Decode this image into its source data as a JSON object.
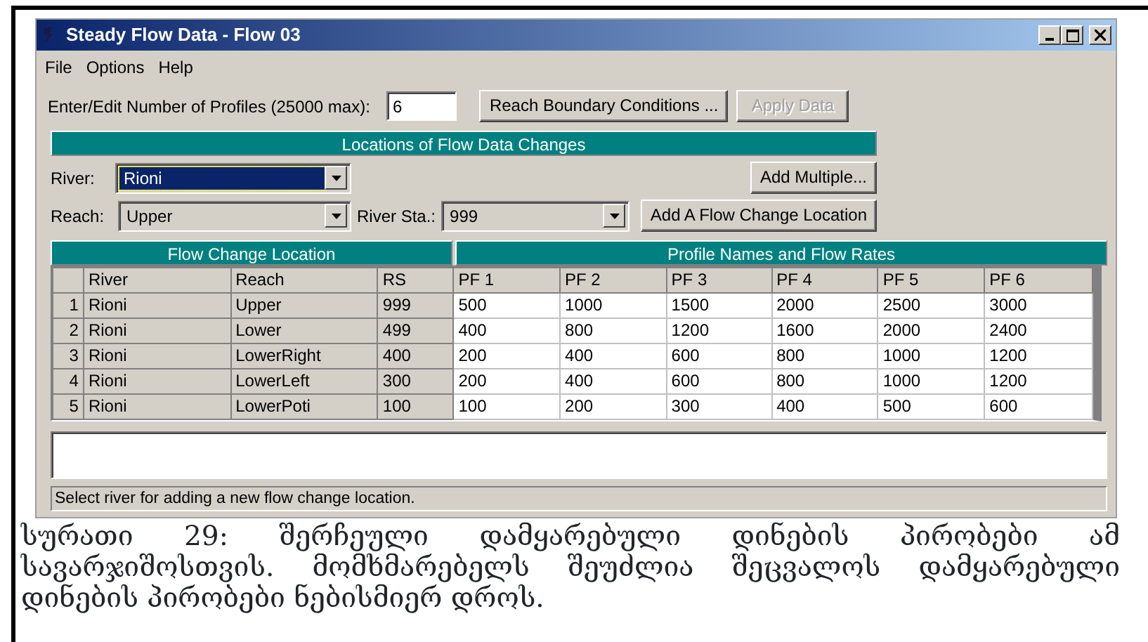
{
  "window": {
    "title": "Steady Flow Data - Flow 03"
  },
  "menu": [
    "File",
    "Options",
    "Help"
  ],
  "profiles": {
    "label": "Enter/Edit Number of Profiles (25000 max):",
    "value": "6"
  },
  "top_buttons": [
    {
      "label": "Reach Boundary Conditions ...",
      "disabled": false
    },
    {
      "label": "Apply Data",
      "disabled": true
    }
  ],
  "locations_header": "Locations of Flow Data Changes",
  "river": {
    "label": "River:",
    "value": "Rioni",
    "selected": true
  },
  "add_multiple": "Add Multiple...",
  "reach": {
    "label": "Reach:",
    "value": "Upper"
  },
  "river_sta": {
    "label": "River Sta.:",
    "value": "999"
  },
  "add_location": "Add A Flow Change Location",
  "table": {
    "group_headers": [
      "Flow Change Location",
      "Profile Names and Flow Rates"
    ],
    "columns": [
      "River",
      "Reach",
      "RS",
      "PF 1",
      "PF 2",
      "PF 3",
      "PF 4",
      "PF 5",
      "PF 6"
    ],
    "rows": [
      {
        "num": "1",
        "cells": [
          "Rioni",
          "Upper",
          "999",
          "500",
          "1000",
          "1500",
          "2000",
          "2500",
          "3000"
        ]
      },
      {
        "num": "2",
        "cells": [
          "Rioni",
          "Lower",
          "499",
          "400",
          "800",
          "1200",
          "1600",
          "2000",
          "2400"
        ]
      },
      {
        "num": "3",
        "cells": [
          "Rioni",
          "LowerRight",
          "400",
          "200",
          "400",
          "600",
          "800",
          "1000",
          "1200"
        ]
      },
      {
        "num": "4",
        "cells": [
          "Rioni",
          "LowerLeft",
          "300",
          "200",
          "400",
          "600",
          "800",
          "1000",
          "1200"
        ]
      },
      {
        "num": "5",
        "cells": [
          "Rioni",
          "LowerPoti",
          "100",
          "100",
          "200",
          "300",
          "400",
          "500",
          "600"
        ]
      }
    ]
  },
  "status_bar": "Select river for adding a new flow change location.",
  "caption": "სურათი 29: შერჩეული დამყარებული დინების პირობები ამ სავარჯიშოსთვის. მომხმარებელს შეუძლია შეცვალოს დამყარებული დინების პირობები ნებისმიერ დროს."
}
